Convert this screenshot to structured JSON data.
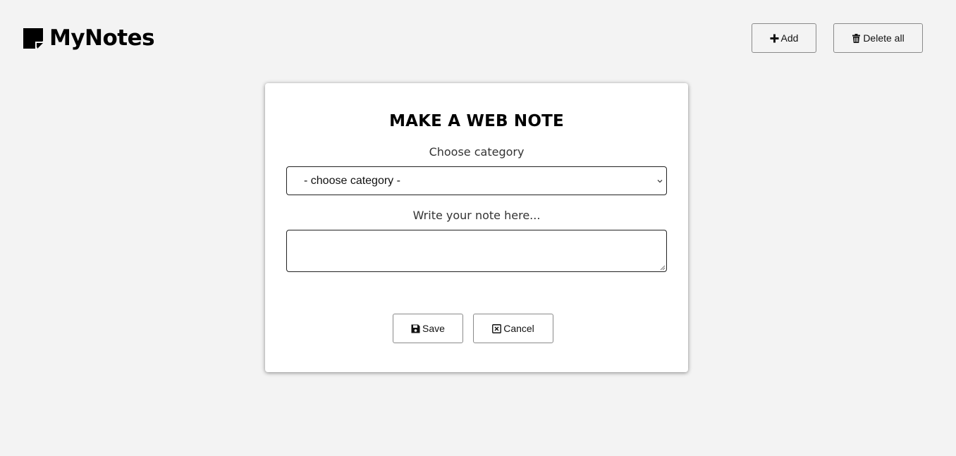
{
  "header": {
    "brand_name": "MyNotes",
    "brand_icon": "sticky-note-icon",
    "add_label": "Add",
    "add_icon": "plus-icon",
    "delete_all_label": "Delete all",
    "delete_all_icon": "trash-icon"
  },
  "form": {
    "title": "MAKE A WEB NOTE",
    "category_label": "Choose category",
    "category_selected": "- choose category -",
    "note_label": "Write your note here...",
    "note_value": "",
    "save_label": "Save",
    "save_icon": "floppy-disk-icon",
    "cancel_label": "Cancel",
    "cancel_icon": "close-box-icon"
  },
  "colors": {
    "background": "#f3f3f3",
    "card": "#ffffff",
    "text": "#000000",
    "border": "#8a8a8a"
  }
}
